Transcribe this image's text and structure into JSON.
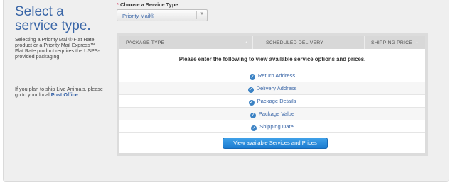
{
  "intro": {
    "title": "Select a service type.",
    "description": "Selecting a Priority Mail® Flat Rate product or a Priority Mail Express™ Flat Rate product requires the USPS-provided packaging.",
    "live_animals_text": "If you plan to ship Live Animals, please go to your local",
    "live_animals_link": "Post Office",
    "live_animals_suffix": "."
  },
  "service_type": {
    "required_mark": "*",
    "label": "Choose a Service Type",
    "selected": "Priority Mail®"
  },
  "table": {
    "columns": [
      "PACKAGE TYPE",
      "SCHEDULED DELIVERY",
      "SHIPPING PRICE"
    ],
    "prompt": "Please enter the following to view available service options and prices.",
    "requirements": [
      "Return Address",
      "Delivery Address",
      "Package Details",
      "Package Value",
      "Shipping Date"
    ],
    "button_label": "View available Services and Prices"
  },
  "icons": {
    "check": "check-circle-icon",
    "dropdown": "chevron-down-icon",
    "sort": "sort-icon"
  },
  "colors": {
    "accent": "#3a66a7",
    "button": "#1a7bd0",
    "check": "#3b82c4"
  }
}
